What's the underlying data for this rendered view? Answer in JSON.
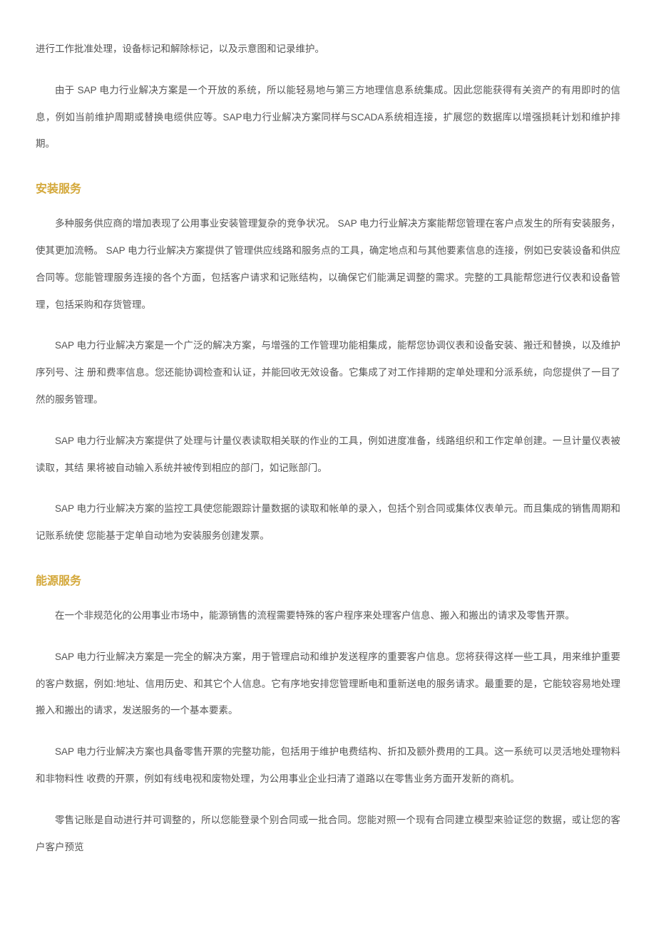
{
  "paragraphs": {
    "p1": "进行工作批准处理，设备标记和解除标记，以及示意图和记录维护。",
    "p2": "由于 SAP 电力行业解决方案是一个开放的系统，所以能轻易地与第三方地理信息系统集成。因此您能获得有关资产的有用即时的信息，例如当前维护周期或替换电缆供应等。SAP电力行业解决方案同样与SCADA系统相连接，扩展您的数据库以增强损耗计划和维护排期。"
  },
  "section1": {
    "heading": "安装服务",
    "p1": "多种服务供应商的增加表现了公用事业安装管理复杂的竞争状况。 SAP 电力行业解决方案能帮您管理在客户点发生的所有安装服务，使其更加流畅。 SAP 电力行业解决方案提供了管理供应线路和服务点的工具，确定地点和与其他要素信息的连接，例如已安装设备和供应合同等。您能管理服务连接的各个方面，包括客户请求和记账结构，以确保它们能满足调整的需求。完整的工具能帮您进行仪表和设备管理，包括采购和存货管理。",
    "p2": "SAP 电力行业解决方案是一个广泛的解决方案，与增强的工作管理功能相集成，能帮您协调仪表和设备安装、搬迁和替换，以及维护序列号、注 册和费率信息。您还能协调检查和认证，并能回收无效设备。它集成了对工作排期的定单处理和分派系统，向您提供了一目了然的服务管理。",
    "p3": "SAP 电力行业解决方案提供了处理与计量仪表读取相关联的作业的工具，例如进度准备，线路组织和工作定单创建。一旦计量仪表被读取，其结 果将被自动输入系统并被传到相应的部门，如记账部门。",
    "p4": "SAP 电力行业解决方案的监控工具使您能跟踪计量数据的读取和帐单的录入，包括个别合同或集体仪表单元。而且集成的销售周期和记账系统使 您能基于定单自动地为安装服务创建发票。"
  },
  "section2": {
    "heading": "能源服务",
    "p1": "在一个非规范化的公用事业市场中，能源销售的流程需要特殊的客户程序来处理客户信息、搬入和搬出的请求及零售开票。",
    "p2": "SAP 电力行业解决方案是一完全的解决方案，用于管理启动和维护发送程序的重要客户信息。您将获得这样一些工具，用来维护重要的客户数据，例如:地址、信用历史、和其它个人信息。它有序地安排您管理断电和重新送电的服务请求。最重要的是，它能较容易地处理搬入和搬出的请求，发送服务的一个基本要素。",
    "p3": "SAP 电力行业解决方案也具备零售开票的完整功能，包括用于维护电费结构、折扣及额外费用的工具。这一系统可以灵活地处理物料和非物料性 收费的开票，例如有线电视和废物处理，为公用事业企业扫清了道路以在零售业务方面开发新的商机。",
    "p4": "零售记账是自动进行并可调整的，所以您能登录个别合同或一批合同。您能对照一个现有合同建立模型来验证您的数据，或让您的客户客户预览"
  }
}
